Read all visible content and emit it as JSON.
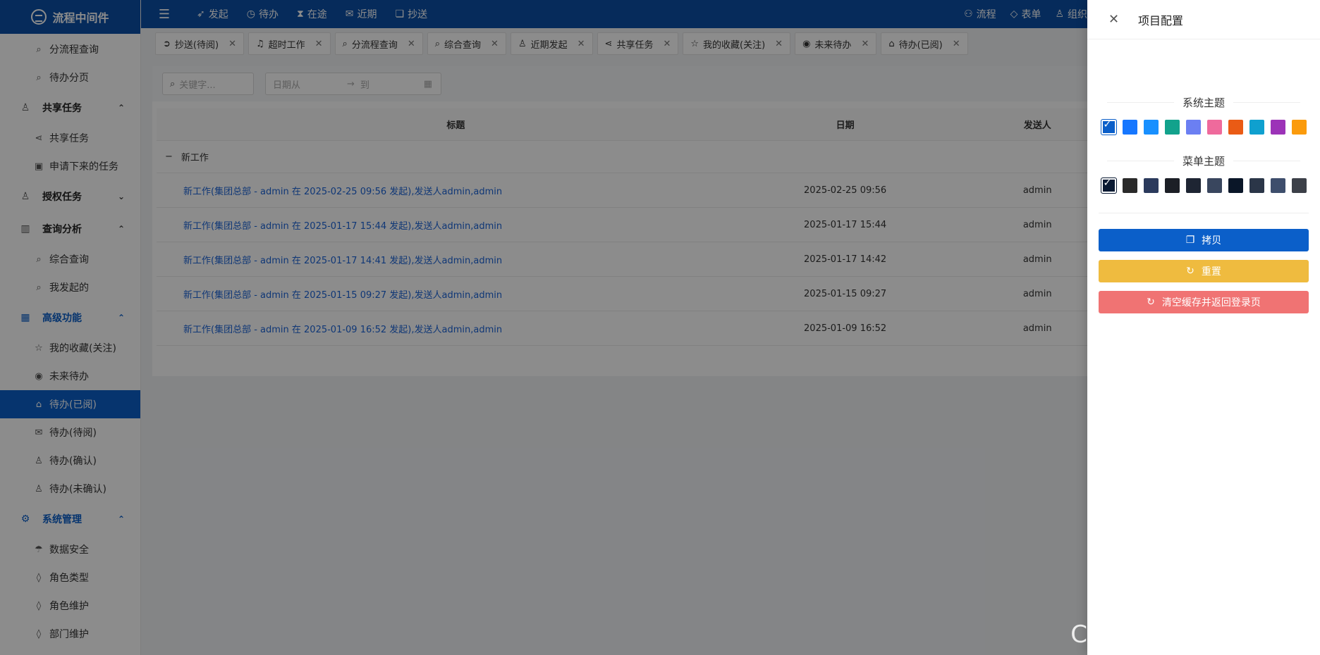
{
  "app": {
    "name": "流程中间件"
  },
  "sidebar": {
    "items": [
      {
        "type": "item",
        "label": "分流程查询",
        "icon": "search-icon",
        "glyph": "⌕"
      },
      {
        "type": "item",
        "label": "待办分页",
        "icon": "search-icon",
        "glyph": "⌕"
      },
      {
        "type": "group",
        "label": "共享任务",
        "icon": "share-user-icon",
        "glyph": "♙",
        "expanded": true
      },
      {
        "type": "item",
        "label": "共享任务",
        "icon": "share-icon",
        "glyph": "⋖"
      },
      {
        "type": "item",
        "label": "申请下来的任务",
        "icon": "clipboard-icon",
        "glyph": "▣"
      },
      {
        "type": "group",
        "label": "授权任务",
        "icon": "user-key-icon",
        "glyph": "♙",
        "expanded": false
      },
      {
        "type": "group",
        "label": "查询分析",
        "icon": "bar-chart-icon",
        "glyph": "▥",
        "expanded": true
      },
      {
        "type": "item",
        "label": "综合查询",
        "icon": "search-icon",
        "glyph": "⌕"
      },
      {
        "type": "item",
        "label": "我发起的",
        "icon": "search-icon",
        "glyph": "⌕"
      },
      {
        "type": "group",
        "label": "高级功能",
        "icon": "grid-icon",
        "glyph": "▦",
        "expanded": true,
        "active": true
      },
      {
        "type": "item",
        "label": "我的收藏(关注)",
        "icon": "star-icon",
        "glyph": "☆"
      },
      {
        "type": "item",
        "label": "未来待办",
        "icon": "eye-icon",
        "glyph": "◉"
      },
      {
        "type": "item",
        "label": "待办(已阅)",
        "icon": "mail-open-icon",
        "glyph": "⌂",
        "selected": true
      },
      {
        "type": "item",
        "label": "待办(待阅)",
        "icon": "mail-icon",
        "glyph": "✉"
      },
      {
        "type": "item",
        "label": "待办(确认)",
        "icon": "user-icon",
        "glyph": "♙"
      },
      {
        "type": "item",
        "label": "待办(未确认)",
        "icon": "user-icon",
        "glyph": "♙"
      },
      {
        "type": "group",
        "label": "系统管理",
        "icon": "gear-icon",
        "glyph": "⚙",
        "expanded": true,
        "active": true
      },
      {
        "type": "item",
        "label": "数据安全",
        "icon": "umbrella-icon",
        "glyph": "☂"
      },
      {
        "type": "item",
        "label": "角色类型",
        "icon": "drop-icon",
        "glyph": "◊"
      },
      {
        "type": "item",
        "label": "角色维护",
        "icon": "drop-icon",
        "glyph": "◊"
      },
      {
        "type": "item",
        "label": "部门维护",
        "icon": "drop-icon",
        "glyph": "◊"
      }
    ]
  },
  "topnav": {
    "left": [
      {
        "label": "发起",
        "icon": "send-icon",
        "glyph": "➶"
      },
      {
        "label": "待办",
        "icon": "clock-icon",
        "glyph": "◷"
      },
      {
        "label": "在途",
        "icon": "hourglass-icon",
        "glyph": "⧗"
      },
      {
        "label": "近期",
        "icon": "mail-icon",
        "glyph": "✉"
      },
      {
        "label": "抄送",
        "icon": "copy-icon",
        "glyph": "❏"
      }
    ],
    "right": [
      {
        "label": "流程",
        "icon": "org-chart-icon",
        "glyph": "⚇"
      },
      {
        "label": "表单",
        "icon": "diamond-icon",
        "glyph": "◇"
      },
      {
        "label": "组织",
        "icon": "user-icon",
        "glyph": "♙"
      }
    ]
  },
  "tabs": [
    {
      "label": "抄送(待阅)",
      "icon": "arrow-circle-icon",
      "glyph": "➲"
    },
    {
      "label": "超时工作",
      "icon": "bell-icon",
      "glyph": "♫"
    },
    {
      "label": "分流程查询",
      "icon": "search-icon",
      "glyph": "⌕"
    },
    {
      "label": "综合查询",
      "icon": "search-icon",
      "glyph": "⌕"
    },
    {
      "label": "近期发起",
      "icon": "user-icon",
      "glyph": "♙"
    },
    {
      "label": "共享任务",
      "icon": "share-icon",
      "glyph": "⋖"
    },
    {
      "label": "我的收藏(关注)",
      "icon": "star-icon",
      "glyph": "☆"
    },
    {
      "label": "未来待办",
      "icon": "eye-icon",
      "glyph": "◉"
    },
    {
      "label": "待办(已阅)",
      "icon": "mail-open-icon",
      "glyph": "⌂"
    }
  ],
  "filters": {
    "keyword_placeholder": "关键字...",
    "date_from_placeholder": "日期从",
    "date_to_placeholder": "到"
  },
  "table": {
    "headers": {
      "title": "标题",
      "date": "日期",
      "sender": "发送人"
    },
    "group_label": "新工作",
    "rows": [
      {
        "title": "新工作(集团总部 - admin 在 2025-02-25 09:56 发起),发送人admin,admin",
        "date": "2025-02-25 09:56",
        "sender": "admin"
      },
      {
        "title": "新工作(集团总部 - admin 在 2025-01-17 15:44 发起),发送人admin,admin",
        "date": "2025-01-17 15:44",
        "sender": "admin"
      },
      {
        "title": "新工作(集团总部 - admin 在 2025-01-17 14:41 发起),发送人admin,admin",
        "date": "2025-01-17 14:42",
        "sender": "admin"
      },
      {
        "title": "新工作(集团总部 - admin 在 2025-01-15 09:27 发起),发送人admin,admin",
        "date": "2025-01-15 09:27",
        "sender": "admin"
      },
      {
        "title": "新工作(集团总部 - admin 在 2025-01-09 16:52 发起),发送人admin,admin",
        "date": "2025-01-09 16:52",
        "sender": "admin"
      }
    ]
  },
  "drawer": {
    "title": "项目配置",
    "system_theme_label": "系统主题",
    "system_theme_colors": [
      "#0b5fc9",
      "#1677ff",
      "#1890ff",
      "#12a28c",
      "#6b7ff2",
      "#ef6a9c",
      "#ea5b15",
      "#0fa0cf",
      "#9c33b8",
      "#fb9b0c"
    ],
    "system_theme_selected": 0,
    "menu_theme_label": "菜单主题",
    "menu_theme_colors": [
      "#0a1a33",
      "#2a2a2a",
      "#2b3a5c",
      "#1c1f26",
      "#1e2533",
      "#39465e",
      "#0a1628",
      "#2b3648",
      "#3e4e6c",
      "#3c4048"
    ],
    "menu_theme_selected": 0,
    "buttons": {
      "copy": "拷贝",
      "reset": "重置",
      "clear": "清空缓存并返回登录页"
    }
  },
  "watermark": "CSDN @牛油果爱编程"
}
